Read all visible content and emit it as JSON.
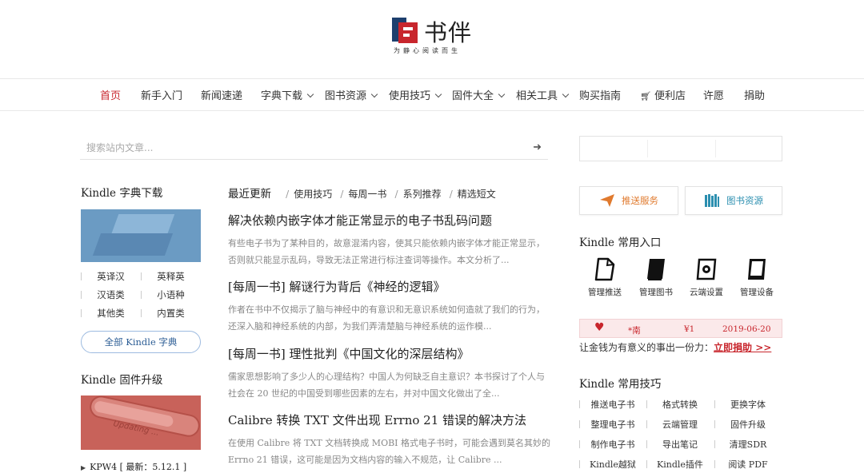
{
  "header": {
    "logo_name": "书伴",
    "slogan": "为静心阅读而生"
  },
  "nav": {
    "items": [
      {
        "label": "首页",
        "active": true,
        "dropdown": false
      },
      {
        "label": "新手入门",
        "dropdown": false
      },
      {
        "label": "新闻速递",
        "dropdown": false
      },
      {
        "label": "字典下载",
        "dropdown": true
      },
      {
        "label": "图书资源",
        "dropdown": true
      },
      {
        "label": "使用技巧",
        "dropdown": true
      },
      {
        "label": "固件大全",
        "dropdown": true
      },
      {
        "label": "相关工具",
        "dropdown": true
      },
      {
        "label": "购买指南",
        "dropdown": false
      },
      {
        "label": "便利店",
        "dropdown": false,
        "icon": "cart-icon"
      },
      {
        "label": "许愿",
        "dropdown": false
      },
      {
        "label": "捐助",
        "dropdown": false
      }
    ]
  },
  "search": {
    "placeholder": "搜索站内文章...",
    "arrow": "➜"
  },
  "left": {
    "dict_title": "Kindle 字典下载",
    "dict_links": [
      "英译汉",
      "英释英",
      "汉语类",
      "小语种",
      "其他类",
      "内置类"
    ],
    "all_dict_button": "全部 Kindle 字典",
    "firmware_title": "Kindle 固件升级",
    "firmware_image_text": "Updating ...",
    "firmware_item": "KPW4 [ 最新：5.12.1 ]"
  },
  "main": {
    "tab_main": "最近更新",
    "tabs": [
      "使用技巧",
      "每周一书",
      "系列推荐",
      "精选短文"
    ],
    "articles": [
      {
        "title": "解决依赖内嵌字体才能正常显示的电子书乱码问题",
        "summary": "有些电子书为了某种目的，故意混淆内容，使其只能依赖内嵌字体才能正常显示，否则就只能显示乱码，导致无法正常进行标注查词等操作。本文分析了..."
      },
      {
        "title": "[每周一书] 解谜行为背后《神经的逻辑》",
        "summary": "作者在书中不仅揭示了脑与神经中的有意识和无意识系统如何造就了我们的行为，还深入脑和神经系统的内部，为我们弄清楚脑与神经系统的运作模..."
      },
      {
        "title": "[每周一书] 理性批判《中国文化的深层结构》",
        "summary": "儒家思想影响了多少人的心理结构？中国人为何缺乏自主意识？本书探讨了个人与社会在 20 世纪的中国受到哪些因素的左右，并对中国文化做出了全..."
      },
      {
        "title": "Calibre 转换 TXT 文件出现 Errno 21 错误的解决方法",
        "summary": "在使用 Calibre 将 TXT 文档转换成 MOBI 格式电子书时，可能会遇到莫名其妙的 Errno 21 错误，这可能是因为文档内容的输入不规范，让 Calibre ..."
      }
    ]
  },
  "right": {
    "push_button": "推送服务",
    "books_button": "图书资源",
    "entry_title": "Kindle 常用入口",
    "entries": [
      {
        "label": "管理推送",
        "icon": "document-icon"
      },
      {
        "label": "管理图书",
        "icon": "book-icon"
      },
      {
        "label": "云端设置",
        "icon": "cloud-settings-icon"
      },
      {
        "label": "管理设备",
        "icon": "kindle-device-icon"
      }
    ],
    "donation": {
      "name": "*南",
      "amount": "¥1",
      "date": "2019-06-20"
    },
    "donate_text": "让金钱为有意义的事出一份力：",
    "donate_link": "立即捐助 >>",
    "tips_title": "Kindle 常用技巧",
    "tips": [
      "推送电子书",
      "格式转换",
      "更换字体",
      "整理电子书",
      "云端管理",
      "固件升级",
      "制作电子书",
      "导出笔记",
      "清理SDR",
      "Kindle越狱",
      "Kindle插件",
      "阅读 PDF"
    ]
  },
  "colors": {
    "accent_red": "#c8262d",
    "brand_navy": "#1d3f6e",
    "push_orange": "#e07a2e",
    "books_blue": "#2c8fb0"
  }
}
